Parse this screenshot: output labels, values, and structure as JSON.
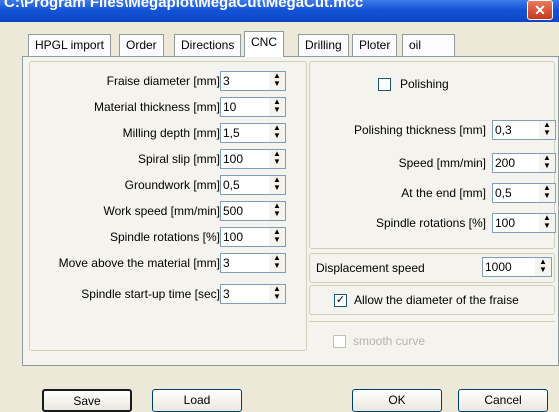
{
  "window": {
    "title": "C:\\Program Files\\Megaplot\\MegaCut\\MegaCut.mcc",
    "close_glyph": "✕"
  },
  "tabs": [
    {
      "label": "HPGL import",
      "active": false
    },
    {
      "label": "Order",
      "active": false
    },
    {
      "label": "Directions",
      "active": false
    },
    {
      "label": "CNC",
      "active": true
    },
    {
      "label": "Drilling",
      "active": false
    },
    {
      "label": "Ploter",
      "active": false
    },
    {
      "label": "oil",
      "active": false
    }
  ],
  "left_fields": [
    {
      "label": "Fraise diameter [mm]",
      "value": "3"
    },
    {
      "label": "Material thickness [mm]",
      "value": "10"
    },
    {
      "label": "Milling depth [mm]",
      "value": "1,5"
    },
    {
      "label": "Spiral slip [mm]",
      "value": "100"
    },
    {
      "label": "Groundwork [mm]",
      "value": "0,5"
    },
    {
      "label": "Work speed [mm/min]",
      "value": "500"
    },
    {
      "label": "Spindle rotations [%]",
      "value": "100"
    },
    {
      "label": "Move above the material [mm]",
      "value": "3"
    },
    {
      "label": "Spindle start-up time [sec]",
      "value": "3"
    }
  ],
  "polishing": {
    "label": "Polishing",
    "checked": false,
    "fields": [
      {
        "label": "Polishing thickness [mm]",
        "value": "0,3"
      },
      {
        "label": "Speed [mm/min]",
        "value": "200"
      },
      {
        "label": "At the end [mm]",
        "value": "0,5"
      },
      {
        "label": "Spindle rotations [%]",
        "value": "100"
      }
    ]
  },
  "displacement": {
    "label": "Displacement speed",
    "value": "1000"
  },
  "allow_diameter": {
    "label": "Allow the diameter of the fraise",
    "checked": true
  },
  "smooth_curve": {
    "label": "smooth curve",
    "checked": false,
    "enabled": false
  },
  "buttons": {
    "save": "Save",
    "load": "Load",
    "ok": "OK",
    "cancel": "Cancel"
  },
  "colors": {
    "titlebar": "#0a46c8",
    "dialog_bg": "#ece9d8",
    "panel_bg": "#f4f3ee"
  }
}
